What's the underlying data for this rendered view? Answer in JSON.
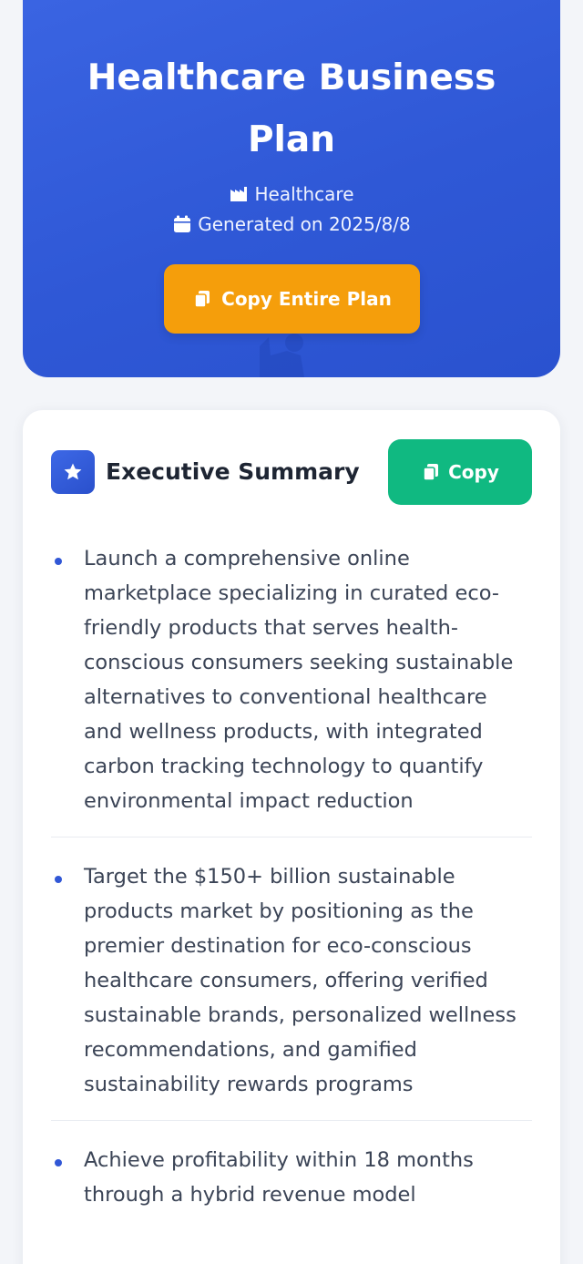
{
  "hero": {
    "title": "Healthcare Business Plan",
    "industry": "Healthcare",
    "generated": "Generated on 2025/8/8",
    "copy_all_label": "Copy Entire Plan",
    "industry_icon": "industry-icon",
    "date_icon": "calendar-icon",
    "copy_icon": "copy-icon"
  },
  "section": {
    "title": "Executive Summary",
    "icon": "star-icon",
    "copy_label": "Copy",
    "items": [
      "Launch a comprehensive online marketplace specializing in curated eco-friendly products that serves health-conscious consumers seeking sustainable alternatives to conventional healthcare and wellness products, with integrated carbon tracking technology to quantify environmental impact reduction",
      "Target the $150+ billion sustainable products market by positioning as the premier destination for eco-conscious healthcare consumers, offering verified sustainable brands, personalized wellness recommendations, and gamified sustainability rewards programs",
      "Achieve profitability within 18 months through a hybrid revenue model"
    ]
  },
  "colors": {
    "hero_bg": "#3159d8",
    "copy_all_bg": "#f59e0b",
    "copy_bg": "#10b981",
    "accent": "#3157d6"
  }
}
